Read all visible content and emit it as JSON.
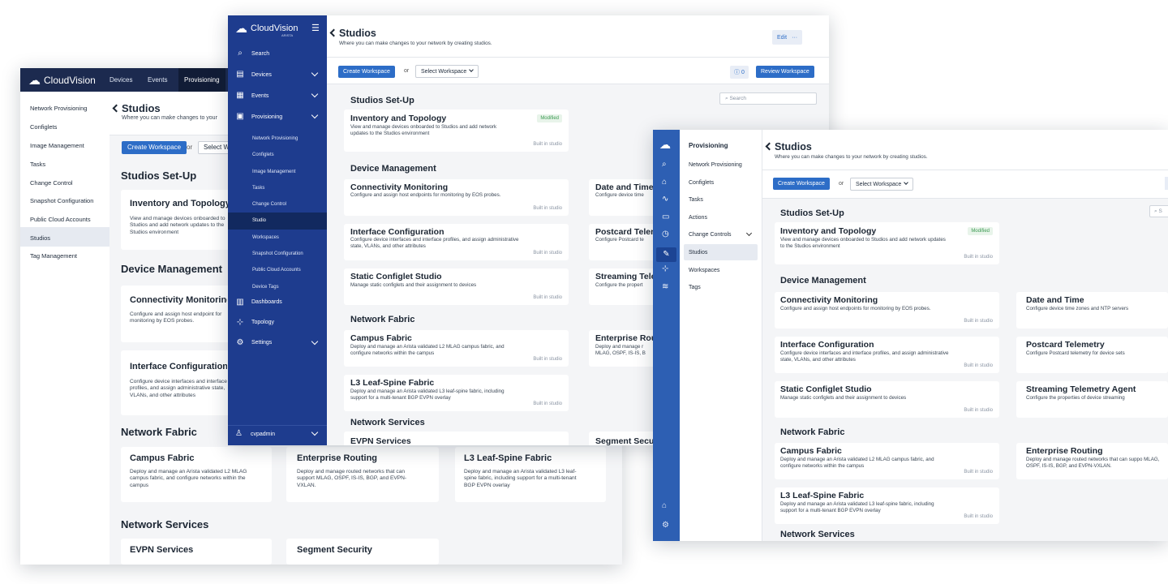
{
  "brand": {
    "name": "CloudVision",
    "sub": "ARISTA"
  },
  "w1": {
    "nav": [
      "Devices",
      "Events",
      "Provisioning"
    ],
    "sidebar": [
      "Network Provisioning",
      "Configlets",
      "Image Management",
      "Tasks",
      "Change Control",
      "Snapshot Configuration",
      "Public Cloud Accounts",
      "Studios",
      "Tag Management"
    ],
    "title": "Studios",
    "subtitle": "Where you can make changes to your",
    "create": "Create Workspace",
    "or": "or",
    "select": "Select W",
    "setup": "Studios Set-Up",
    "inv_title": "Inventory and Topology",
    "inv_desc": "View and manage devices onboarded to Studios and add network updates to the Studios environment",
    "devmgmt": "Device Management",
    "conn_title": "Connectivity Monitoring",
    "conn_desc": "Configure and assign host endpoint for monitoring by EOS probes.",
    "intf_title": "Interface Configuration",
    "intf_desc": "Configure device interfaces and interface profiles, and assign administrative state, VLANs, and other attributes",
    "netfab": "Network Fabric",
    "campus_title": "Campus Fabric",
    "campus_desc": "Deploy and manage an Arista validated L2 MLAG campus fabric, and configure networks within the campus",
    "ent_title": "Enterprise Routing",
    "ent_desc": "Deploy and manage routed networks that can support MLAG, OSPF, IS-IS, BGP, and EVPN-VXLAN.",
    "l3_title": "L3 Leaf-Spine Fabric",
    "l3_desc": "Deploy and manage an Arista validated L3 leaf-spine fabric, including support for a multi-tenant BGP EVPN overlay",
    "netsvc": "Network Services",
    "evpn": "EVPN Services",
    "segsec": "Segment Security"
  },
  "w2": {
    "sidebar": [
      {
        "label": "Search",
        "icon": "search-icon",
        "glyph": "⌕"
      },
      {
        "label": "Devices",
        "icon": "devices-icon",
        "glyph": "▤",
        "chev": true
      },
      {
        "label": "Events",
        "icon": "events-icon",
        "glyph": "▦",
        "chev": true
      },
      {
        "label": "Provisioning",
        "icon": "provisioning-icon",
        "glyph": "▣",
        "chev": true
      }
    ],
    "sub": [
      "Network Provisioning",
      "Configlets",
      "Image Management",
      "Tasks",
      "Change Control",
      "Studio",
      "Workspaces",
      "Snapshot Configuration",
      "Public Cloud Accounts",
      "Device Tags"
    ],
    "lower": [
      {
        "label": "Dashboards",
        "icon": "dashboards-icon",
        "glyph": "▥"
      },
      {
        "label": "Topology",
        "icon": "topology-icon",
        "glyph": "⊹"
      },
      {
        "label": "Settings",
        "icon": "settings-icon",
        "glyph": "⚙",
        "chev": true
      }
    ],
    "user": "cvpadmin",
    "title": "Studios",
    "subtitle": "Where you can make changes to your network by creating studios.",
    "edit": "Edit",
    "more": "···",
    "create": "Create Workspace",
    "or": "or",
    "select": "Select Workspace",
    "count": "0",
    "review": "Review Workspace",
    "search": "Search",
    "setup": "Studios Set-Up",
    "inv_title": "Inventory and Topology",
    "inv_desc": "View and manage devices onboarded to Studios and add network updates to the Studios environment",
    "modified": "Modified",
    "built": "Built in studio",
    "devmgmt": "Device Management",
    "conn_title": "Connectivity Monitoring",
    "conn_desc": "Configure and assign host endpoints for monitoring by EOS probes.",
    "date_title": "Date and Time",
    "date_desc": "Configure device time",
    "intf_title": "Interface Configuration",
    "intf_desc": "Configure device interfaces and interface profiles, and assign administrative state, VLANs, and other attributes",
    "post_title": "Postcard Teler",
    "post_desc": "Configure Postcard te",
    "static_title": "Static Configlet Studio",
    "static_desc": "Manage static configlets and their assignment to devices",
    "stream_title": "Streaming Tele",
    "stream_desc": "Configure the propert",
    "netfab": "Network Fabric",
    "campus_title": "Campus Fabric",
    "campus_desc": "Deploy and manage an Arista validated L2 MLAG campus fabric, and configure networks within the campus",
    "ent_title": "Enterprise Rou",
    "ent_desc": "Deploy and manage r MLAG, OSPF, IS-IS, B",
    "l3_title": "L3 Leaf-Spine Fabric",
    "l3_desc": "Deploy and manage an Arista validated L3 leaf-spine fabric, including support for a multi-tenant BGP EVPN overlay",
    "netsvc": "Network Services",
    "evpn": "EVPN Services",
    "segsec": "Segment Secu"
  },
  "w3": {
    "rail": [
      {
        "icon": "search-icon",
        "glyph": "⌕"
      },
      {
        "icon": "home-icon",
        "glyph": "⌂"
      },
      {
        "icon": "activity-icon",
        "glyph": "∿"
      },
      {
        "icon": "calendar-icon",
        "glyph": "▭"
      },
      {
        "icon": "alarm-icon",
        "glyph": "◷"
      },
      {
        "icon": "wrench-icon",
        "glyph": "✎"
      },
      {
        "icon": "topology-icon",
        "glyph": "⊹"
      },
      {
        "icon": "chart-icon",
        "glyph": "≋"
      }
    ],
    "panel_title": "Provisioning",
    "panel": [
      "Network Provisioning",
      "Configlets",
      "Tasks",
      "Actions",
      "Change Controls",
      "Studios",
      "Workspaces",
      "Tags"
    ],
    "title": "Studios",
    "subtitle": "Where you can make changes to your network by creating studios.",
    "create": "Create Workspace",
    "or": "or",
    "select": "Select Workspace",
    "search": "S",
    "setup": "Studios Set-Up",
    "inv_title": "Inventory and Topology",
    "inv_desc": "View and manage devices onboarded to Studios and add network updates to the Studios environment",
    "modified": "Modified",
    "built": "Built in studio",
    "devmgmt": "Device Management",
    "conn_title": "Connectivity Monitoring",
    "conn_desc": "Configure and assign host endpoints for monitoring by EOS probes.",
    "date_title": "Date and Time",
    "date_desc": "Configure device time zones and NTP servers",
    "intf_title": "Interface Configuration",
    "intf_desc": "Configure device interfaces and interface profiles, and assign administrative state, VLANs, and other attributes",
    "post_title": "Postcard Telemetry",
    "post_desc": "Configure Postcard telemetry for device sets",
    "static_title": "Static Configlet Studio",
    "static_desc": "Manage static configlets and their assignment to devices",
    "stream_title": "Streaming Telemetry Agent",
    "stream_desc": "Configure the properties of device streaming",
    "netfab": "Network Fabric",
    "campus_title": "Campus Fabric",
    "campus_desc": "Deploy and manage an Arista validated L2 MLAG campus fabric, and configure networks within the campus",
    "ent_title": "Enterprise Routing",
    "ent_desc": "Deploy and manage routed networks that can suppo MLAG, OSPF, IS-IS, BGP, and EVPN-VXLAN.",
    "l3_title": "L3 Leaf-Spine Fabric",
    "l3_desc": "Deploy and manage an Arista validated L3 leaf-spine fabric, including support for a multi-tenant BGP EVPN overlay",
    "netsvc": "Network Services"
  },
  "colors": {
    "navy": "#1c2a4f",
    "blue": "#2d5fb3",
    "primary": "#2d6dc7",
    "green": "#3c9a52"
  }
}
